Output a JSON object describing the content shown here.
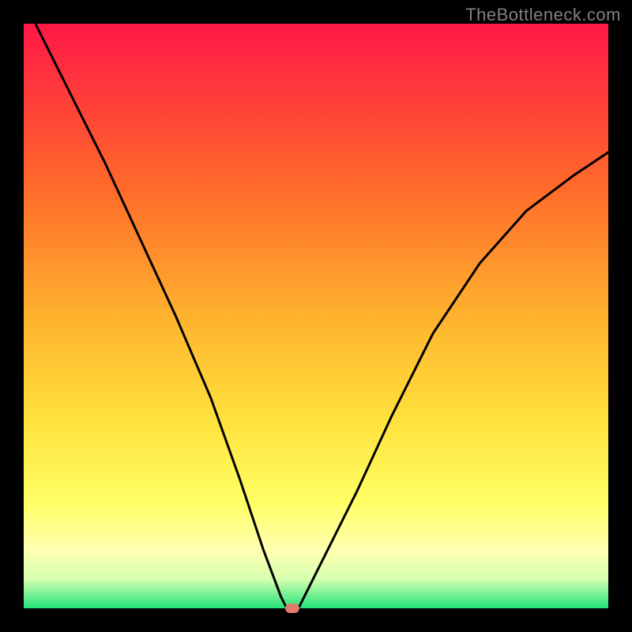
{
  "watermark": "TheBottleneck.com",
  "chart_data": {
    "type": "line",
    "title": "",
    "xlabel": "",
    "ylabel": "",
    "xlim": [
      0,
      100
    ],
    "ylim": [
      0,
      100
    ],
    "gradient_colors": {
      "top": "#ff1846",
      "bottom": "#22e27a"
    },
    "series": [
      {
        "name": "bottleneck-curve",
        "x": [
          2,
          8,
          14,
          20,
          26,
          32,
          37,
          41,
          44,
          45,
          46,
          47,
          48,
          52,
          57,
          63,
          70,
          78,
          86,
          94,
          100
        ],
        "y": [
          100,
          88,
          76,
          63,
          50,
          36,
          22,
          10,
          2,
          0,
          0,
          0,
          2,
          10,
          20,
          33,
          47,
          59,
          68,
          74,
          78
        ]
      }
    ],
    "marker": {
      "x": 46,
      "y": 0,
      "color": "#e07a6a"
    },
    "annotations": []
  }
}
